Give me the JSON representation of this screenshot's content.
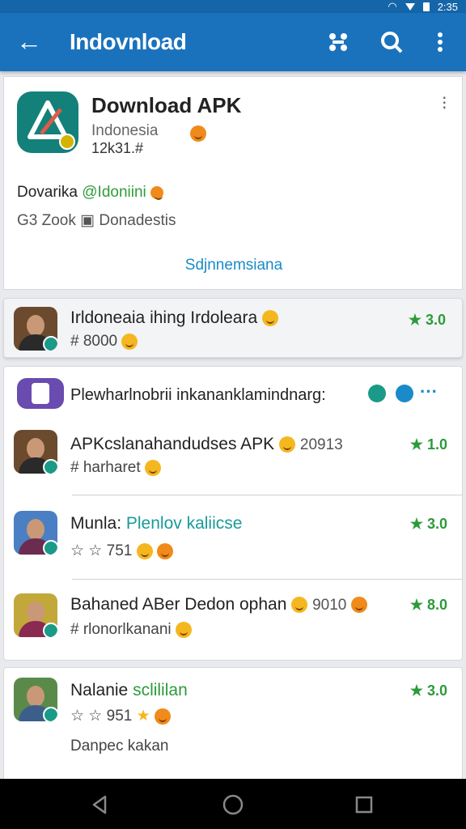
{
  "status": {
    "time": "2:35"
  },
  "app_bar": {
    "title": "Indovnload"
  },
  "hero": {
    "title": "Download APK",
    "subtitle": "Indonesia",
    "id_line": "12k31.#",
    "developer_prefix": "Dovarika",
    "developer_handle": "@Idoniini",
    "meta": "G3 Zook",
    "meta_tag": "Donadestis",
    "link": "Sdjnnemsiana"
  },
  "featured": {
    "title": "Irldoneaia ihing Irdoleara",
    "subtitle": "# 8000",
    "rating": "3.0"
  },
  "group1": {
    "header": "Plewharlnobrii inkananklamindnarg:",
    "items": [
      {
        "title": "APKcslanahandudses APK",
        "extra": "20913",
        "subtitle": "# harharet",
        "rating": "1.0"
      },
      {
        "title": "Munla:",
        "title_accent": "Plenlov kaliicse",
        "subtitle": "☆ ☆ 751",
        "rating": "3.0"
      },
      {
        "title": "Bahaned ABer Dedon ophan",
        "extra": "9010",
        "subtitle": "# rlonorlkanani",
        "rating": "8.0"
      }
    ]
  },
  "group2": {
    "items": [
      {
        "title": "Nalanie",
        "title_accent": "sclililan",
        "subtitle": "☆ ☆ 951",
        "rating": "3.0",
        "note": "Danpec kakan"
      }
    ]
  },
  "colors": {
    "app_bar": "#1a72bd",
    "rating": "#2d9a3a",
    "link": "#1a8bc8"
  },
  "icons": [
    "back-arrow-icon",
    "shuffle-icon",
    "search-icon",
    "more-vert-icon",
    "star-icon",
    "verified-icon"
  ]
}
